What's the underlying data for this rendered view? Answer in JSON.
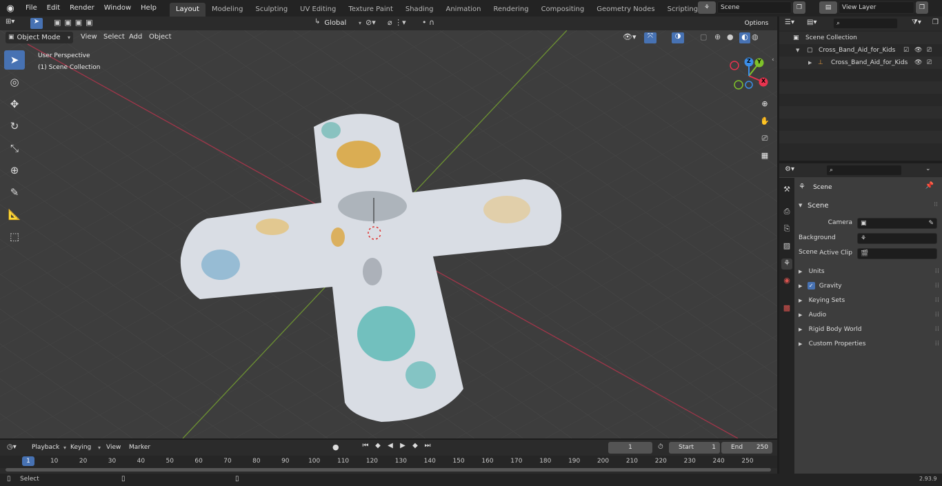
{
  "menu": [
    "File",
    "Edit",
    "Render",
    "Window",
    "Help"
  ],
  "workspaces": [
    "Layout",
    "Modeling",
    "Sculpting",
    "UV Editing",
    "Texture Paint",
    "Shading",
    "Animation",
    "Rendering",
    "Compositing",
    "Geometry Nodes",
    "Scripting"
  ],
  "scene_field": "Scene",
  "view_layer_field": "View Layer",
  "header": {
    "orientation": "Global",
    "options": "Options",
    "mode": "Object Mode",
    "view": "View",
    "select": "Select",
    "add": "Add",
    "object": "Object"
  },
  "viewport": {
    "perspective": "User Perspective",
    "collection": "(1) Scene Collection"
  },
  "gizmo": {
    "x": "X",
    "y": "Y",
    "z": "Z",
    "x_color": "#e8344f",
    "y_color": "#7fc22a",
    "z_color": "#3b8ee8"
  },
  "outliner": {
    "root": "Scene Collection",
    "collection": "Cross_Band_Aid_for_Kids",
    "object": "Cross_Band_Aid_for_Kids"
  },
  "properties": {
    "context": "Scene",
    "panel": "Scene",
    "camera_label": "Camera",
    "bg_scene_label": "Background Scene",
    "active_clip_label": "Active Clip",
    "subpanels": [
      "Units",
      "Gravity",
      "Keying Sets",
      "Audio",
      "Rigid Body World",
      "Custom Properties"
    ]
  },
  "timeline": {
    "playback": "Playback",
    "keying": "Keying",
    "view": "View",
    "marker": "Marker",
    "current_frame": "1",
    "start_label": "Start",
    "start": "1",
    "end_label": "End",
    "end": "250",
    "ticks": [
      "1",
      "10",
      "20",
      "30",
      "40",
      "50",
      "60",
      "70",
      "80",
      "90",
      "100",
      "110",
      "120",
      "130",
      "140",
      "150",
      "160",
      "170",
      "180",
      "190",
      "200",
      "210",
      "220",
      "230",
      "240",
      "250"
    ]
  },
  "status": {
    "select": "Select",
    "version": "2.93.9"
  }
}
